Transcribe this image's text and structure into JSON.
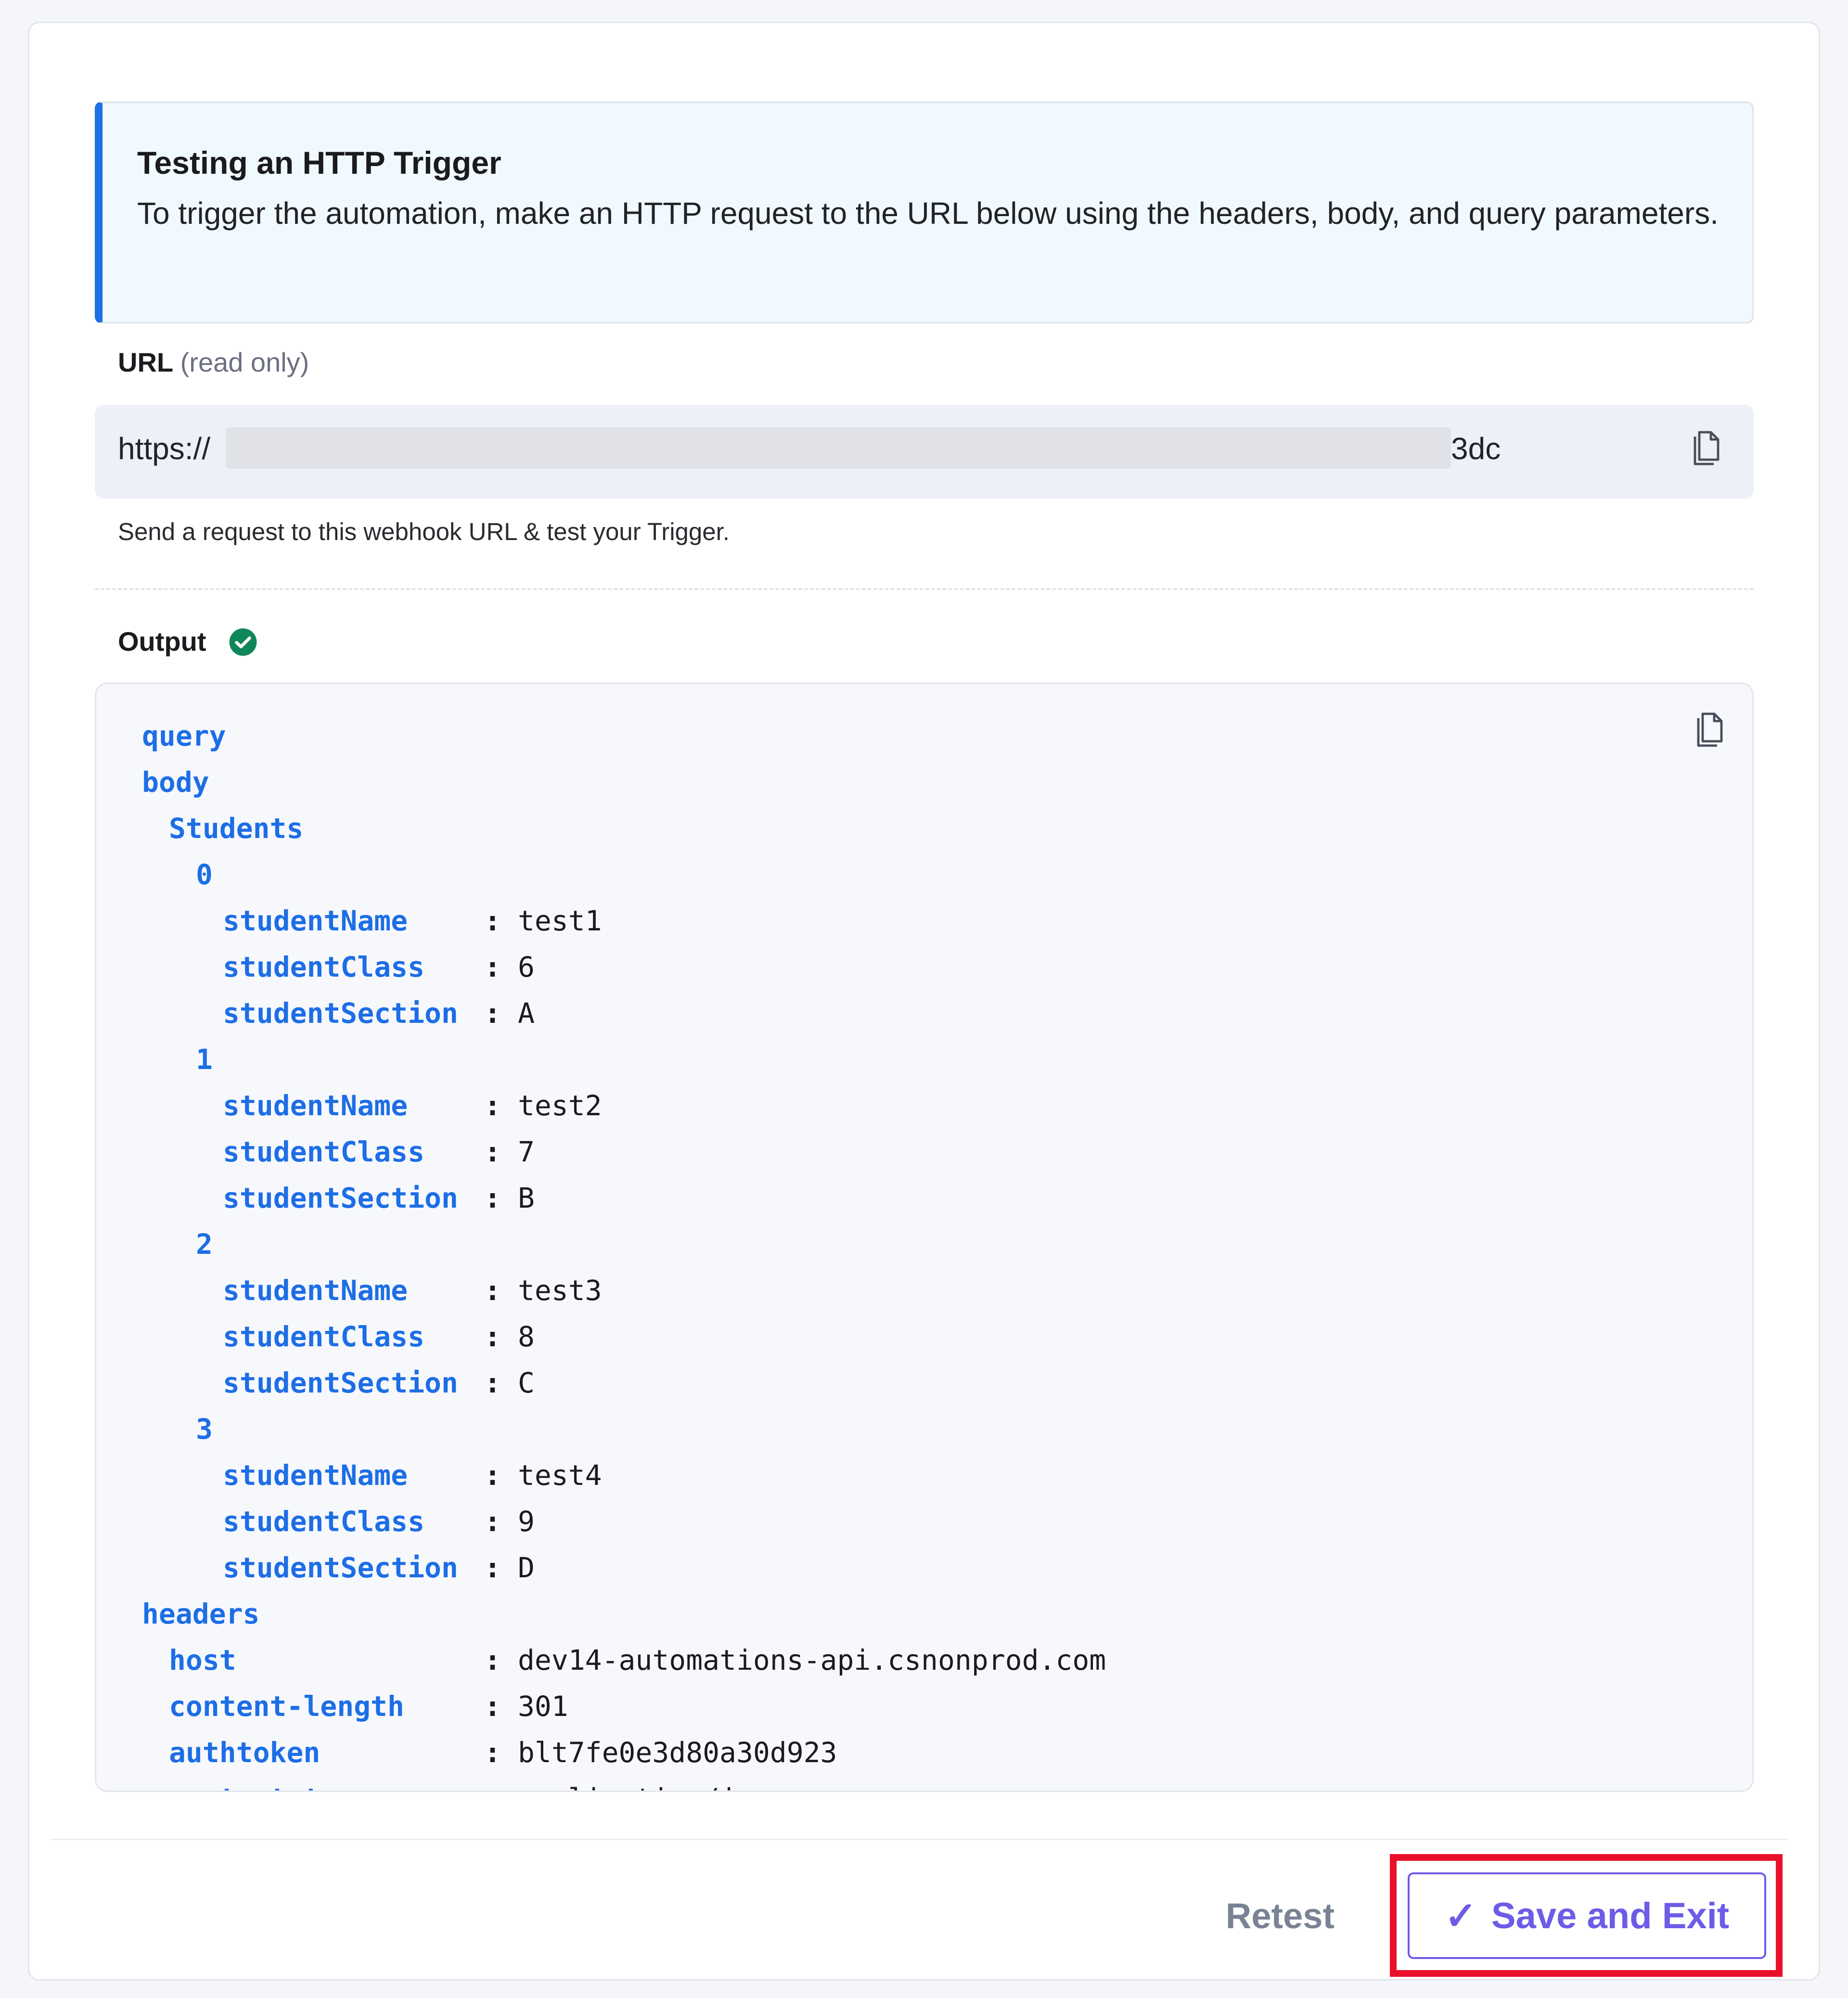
{
  "info": {
    "title": "Testing an HTTP Trigger",
    "description": "To trigger the automation, make an HTTP request to the URL below using the headers, body, and query parameters."
  },
  "url": {
    "label": "URL",
    "label_note": "(read only)",
    "prefix": "https://",
    "suffix": "3dc",
    "help_text": "Send a request to this webhook URL & test your Trigger."
  },
  "output": {
    "label": "Output",
    "status_color": "#10875a",
    "rows": [
      {
        "level": 0,
        "key": "query",
        "value": ""
      },
      {
        "level": 0,
        "key": "body",
        "value": ""
      },
      {
        "level": 1,
        "key": "Students",
        "value": ""
      },
      {
        "level": 2,
        "key": "0",
        "value": ""
      },
      {
        "level": 3,
        "key": "studentName",
        "value": "test1"
      },
      {
        "level": 3,
        "key": "studentClass",
        "value": "6"
      },
      {
        "level": 3,
        "key": "studentSection",
        "value": "A"
      },
      {
        "level": 2,
        "key": "1",
        "value": ""
      },
      {
        "level": 3,
        "key": "studentName",
        "value": "test2"
      },
      {
        "level": 3,
        "key": "studentClass",
        "value": "7"
      },
      {
        "level": 3,
        "key": "studentSection",
        "value": "B"
      },
      {
        "level": 2,
        "key": "2",
        "value": ""
      },
      {
        "level": 3,
        "key": "studentName",
        "value": "test3"
      },
      {
        "level": 3,
        "key": "studentClass",
        "value": "8"
      },
      {
        "level": 3,
        "key": "studentSection",
        "value": "C"
      },
      {
        "level": 2,
        "key": "3",
        "value": ""
      },
      {
        "level": 3,
        "key": "studentName",
        "value": "test4"
      },
      {
        "level": 3,
        "key": "studentClass",
        "value": "9"
      },
      {
        "level": 3,
        "key": "studentSection",
        "value": "D"
      },
      {
        "level": 0,
        "key": "headers",
        "value": ""
      },
      {
        "level": 1,
        "key": "host",
        "value": "dev14-automations-api.csnonprod.com"
      },
      {
        "level": 1,
        "key": "content-length",
        "value": "301"
      },
      {
        "level": 1,
        "key": "authtoken",
        "value": "blt7fe0e3d80a30d923"
      },
      {
        "level": 1,
        "key": "content-type",
        "value": "application/json"
      }
    ]
  },
  "footer": {
    "retest_label": "Retest",
    "save_label": "Save and Exit",
    "save_icon": "✓"
  },
  "colors": {
    "accent_blue": "#1f6fe5",
    "primary_purple": "#6c5ce7",
    "highlight_red": "#e8102a"
  }
}
